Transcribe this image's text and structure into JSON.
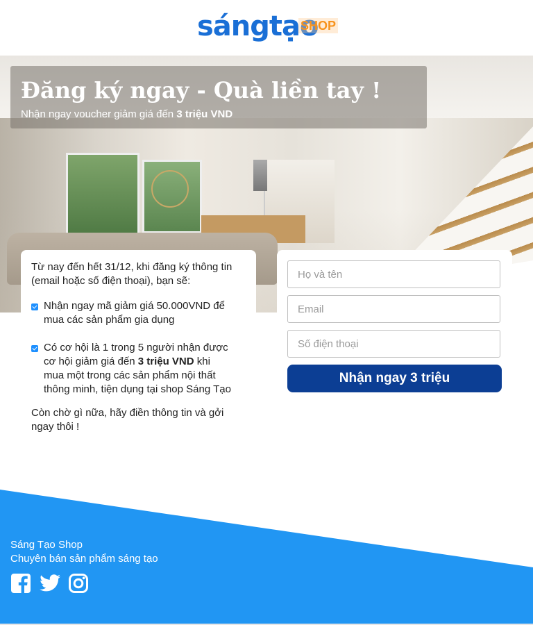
{
  "logo": {
    "main": "sángtạo",
    "shop": "SHOP"
  },
  "hero": {
    "title": "Đăng ký ngay - Quà liền tay !",
    "subtitle_prefix": "Nhận ngay voucher giảm giá đến ",
    "subtitle_bold": "3 triệu VND"
  },
  "info": {
    "intro": "Từ nay đến hết 31/12, khi đăng ký thông tin (email hoặc số điện thoại), bạn sẽ:",
    "benefit1": "Nhận ngay mã giảm giá 50.000VND để mua các sản phẩm gia dụng",
    "benefit2_prefix": "Có cơ hội là 1 trong 5 người nhận được cơ hội giảm giá đến ",
    "benefit2_bold": "3 triệu VND",
    "benefit2_suffix": " khi mua một trong các sản phẩm nội thất thông minh, tiện dụng tại shop Sáng Tạo",
    "outro": "Còn chờ gì nữa, hãy điền thông tin và gởi ngay thôi !"
  },
  "form": {
    "name_placeholder": "Họ và tên",
    "email_placeholder": "Email",
    "phone_placeholder": "Số điện thoại",
    "submit_label": "Nhận ngay 3 triệu"
  },
  "footer": {
    "name": "Sáng Tạo Shop",
    "tagline": "Chuyên bán sản phẩm sáng tạo",
    "social": [
      "facebook-icon",
      "twitter-icon",
      "instagram-icon"
    ]
  },
  "colors": {
    "brand_blue": "#1a6fd6",
    "brand_orange": "#f7931e",
    "button": "#0c3e94",
    "footer": "#2196f3",
    "check": "#1e90ff"
  }
}
